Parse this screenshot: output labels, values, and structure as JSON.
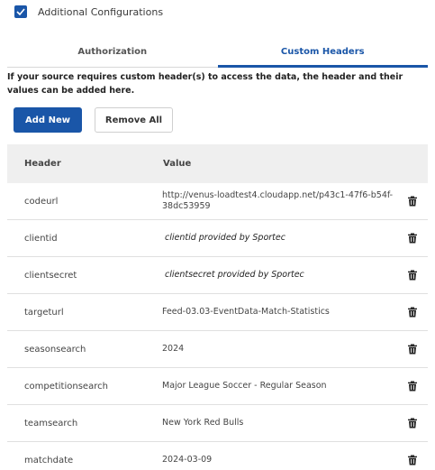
{
  "config": {
    "checkbox_label": "Additional Configurations",
    "checked": true
  },
  "tabs": [
    {
      "label": "Authorization",
      "active": false
    },
    {
      "label": "Custom Headers",
      "active": true
    }
  ],
  "info_text": "If your source requires custom header(s) to access the data, the header and their values can be added here.",
  "buttons": {
    "add_new": "Add New",
    "remove_all": "Remove All"
  },
  "table": {
    "columns": [
      "Header",
      "Value"
    ],
    "rows": [
      {
        "header": "codeurl",
        "value": "http://venus-loadtest4.cloudapp.net/p43c1-47f6-b54f-38dc53959",
        "italic": false
      },
      {
        "header": "clientid",
        "value": "clientid provided by Sportec",
        "italic": true
      },
      {
        "header": "clientsecret",
        "value": "clientsecret provided by Sportec",
        "italic": true
      },
      {
        "header": "targeturl",
        "value": "Feed-03.03-EventData-Match-Statistics",
        "italic": false
      },
      {
        "header": "seasonsearch",
        "value": "2024",
        "italic": false
      },
      {
        "header": "competitionsearch",
        "value": "Major League Soccer - Regular Season",
        "italic": false
      },
      {
        "header": "teamsearch",
        "value": "New York Red Bulls",
        "italic": false
      },
      {
        "header": "matchdate",
        "value": "2024-03-09",
        "italic": false
      }
    ]
  },
  "colors": {
    "accent": "#1a56a8",
    "header_bg": "#efefef"
  },
  "icons": {
    "checkbox": "check-icon",
    "delete": "trash-icon"
  }
}
